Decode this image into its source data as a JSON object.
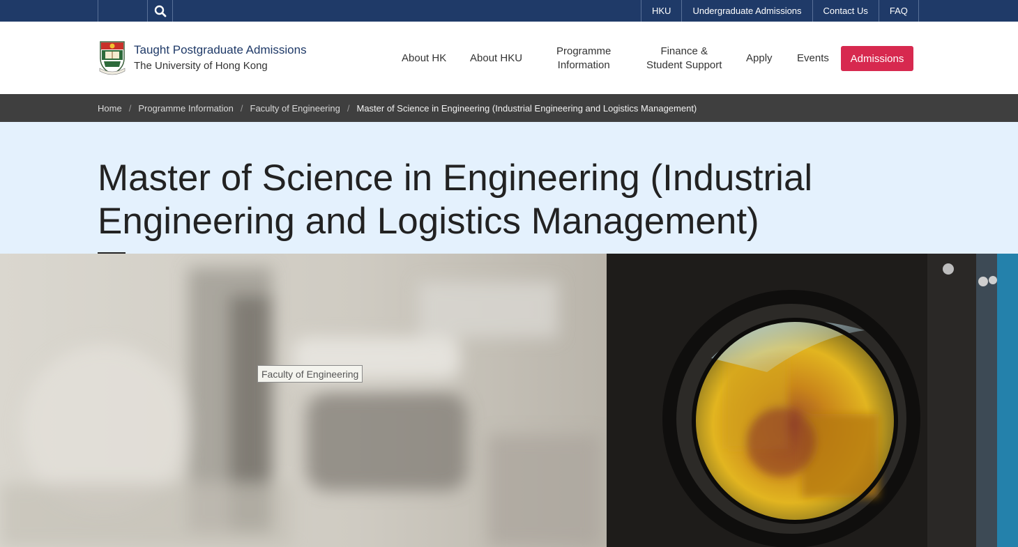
{
  "topbar": {
    "search_icon": "search-icon",
    "links": [
      "HKU",
      "Undergraduate Admissions",
      "Contact Us",
      "FAQ"
    ]
  },
  "header": {
    "brand_title": "Taught Postgraduate Admissions",
    "brand_subtitle": "The University of Hong Kong",
    "logo_icon": "hku-crest-icon",
    "nav": {
      "about_hk": "About HK",
      "about_hku": "About HKU",
      "programme_1": "Programme",
      "programme_2": "Information",
      "finance_1": "Finance &",
      "finance_2": "Student Support",
      "apply": "Apply",
      "events": "Events",
      "admissions": "Admissions"
    }
  },
  "breadcrumb": [
    "Home",
    "Programme Information",
    "Faculty of Engineering",
    "Master of Science in Engineering (Industrial Engineering and Logistics Management)"
  ],
  "page": {
    "title": "Master of Science in Engineering (Industrial Engineering and Logistics Management)"
  },
  "hero": {
    "tooltip": "Faculty of Engineering"
  },
  "colors": {
    "topbar": "#1f3a68",
    "accent": "#d7294f",
    "breadcrumb_bg": "#3f3f3f",
    "title_band": "#e4f1fd"
  }
}
